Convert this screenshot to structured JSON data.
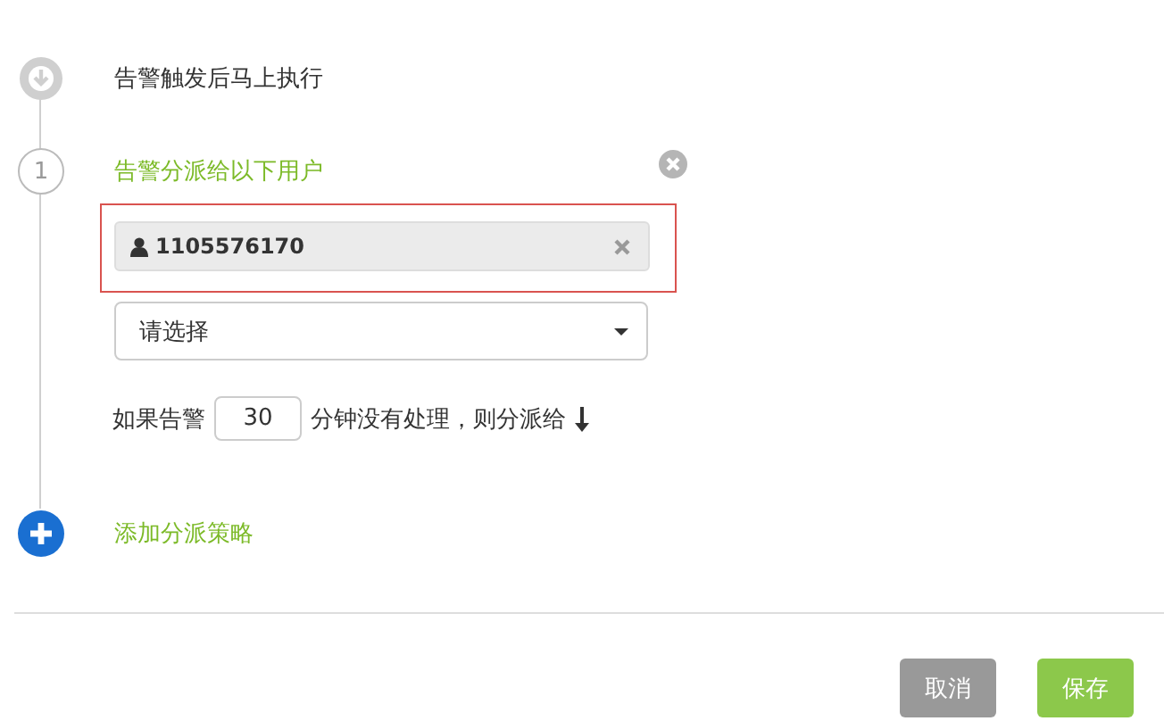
{
  "trigger": {
    "text": "告警触发后马上执行"
  },
  "steps": [
    {
      "number": "1",
      "title": "告警分派给以下用户",
      "users": [
        {
          "name": "1105576170"
        }
      ],
      "select": {
        "placeholder": "请选择"
      },
      "escalation": {
        "prefix": "如果告警",
        "minutes": "30",
        "suffix": "分钟没有处理，则分派给"
      }
    }
  ],
  "add_link": "添加分派策略",
  "buttons": [
    {
      "label": "取消",
      "kind": "cancel"
    },
    {
      "label": "保存",
      "kind": "save"
    }
  ]
}
